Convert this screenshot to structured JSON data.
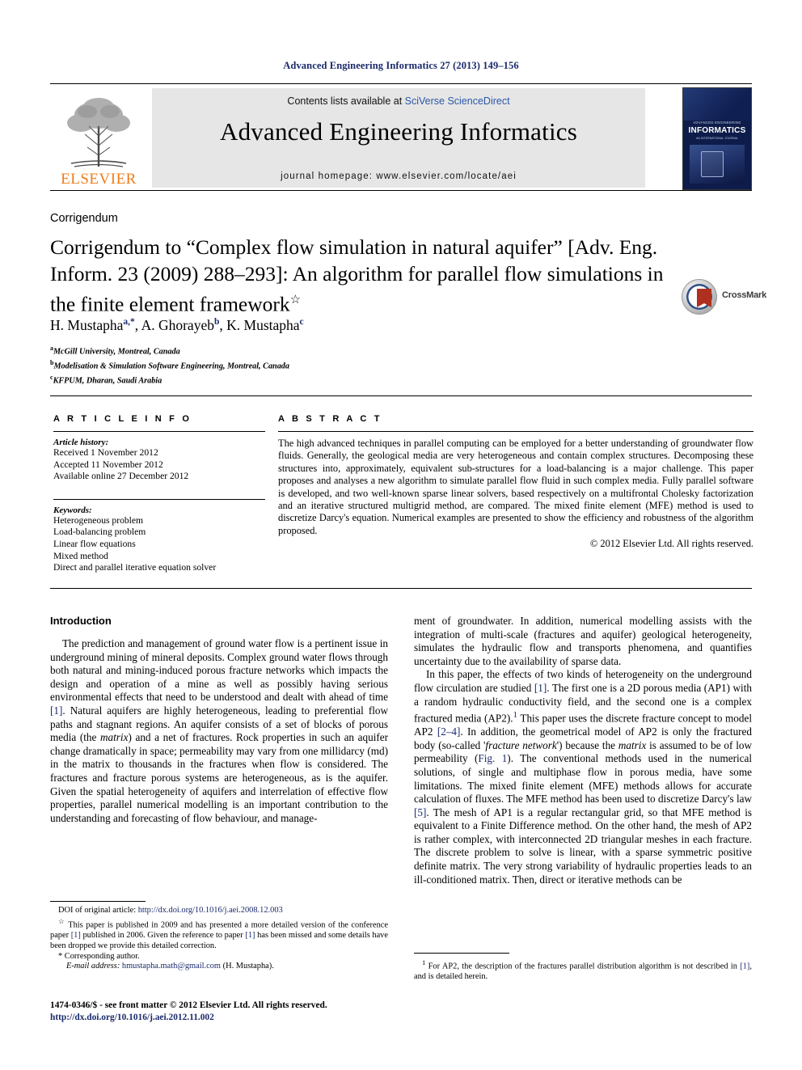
{
  "running_head": "Advanced Engineering Informatics 27 (2013) 149–156",
  "masthead": {
    "contents_prefix": "Contents lists available at ",
    "contents_link": "SciVerse ScienceDirect",
    "journal_title": "Advanced Engineering Informatics",
    "homepage": "journal homepage: www.elsevier.com/locate/aei",
    "publisher_name": "ELSEVIER",
    "cover": {
      "series": "ADVANCED ENGINEERING",
      "name": "INFORMATICS",
      "subtitle": "AN INTERNATIONAL JOURNAL"
    }
  },
  "article_category": "Corrigendum",
  "title": "Corrigendum to “Complex flow simulation in natural aquifer” [Adv. Eng. Inform. 23 (2009) 288–293]: An algorithm for parallel flow simulations in the finite element framework",
  "title_marker": "☆",
  "crossmark_label": "CrossMark",
  "authors": [
    {
      "name": "H. Mustapha",
      "marks": "a,*"
    },
    {
      "name": "A. Ghorayeb",
      "marks": "b"
    },
    {
      "name": "K. Mustapha",
      "marks": "c"
    }
  ],
  "affiliations": [
    {
      "mark": "a",
      "text": "McGill University, Montreal, Canada"
    },
    {
      "mark": "b",
      "text": "Modelisation & Simulation Software Engineering, Montreal, Canada"
    },
    {
      "mark": "c",
      "text": "KFPUM, Dharan, Saudi Arabia"
    }
  ],
  "article_info": {
    "heading": "A R T I C L E   I N F O",
    "history_label": "Article history:",
    "history": [
      "Received 1 November 2012",
      "Accepted 11 November 2012",
      "Available online 27 December 2012"
    ],
    "keywords_label": "Keywords:",
    "keywords": [
      "Heterogeneous problem",
      "Load-balancing problem",
      "Linear flow equations",
      "Mixed method",
      "Direct and parallel iterative equation solver"
    ]
  },
  "abstract": {
    "heading": "A B S T R A C T",
    "text": "The high advanced techniques in parallel computing can be employed for a better understanding of groundwater flow fluids. Generally, the geological media are very heterogeneous and contain complex structures. Decomposing these structures into, approximately, equivalent sub-structures for a load-balancing is a major challenge. This paper proposes and analyses a new algorithm to simulate parallel flow fluid in such complex media. Fully parallel software is developed, and two well-known sparse linear solvers, based respectively on a multifrontal Cholesky factorization and an iterative structured multigrid method, are compared. The mixed finite element (MFE) method is used to discretize Darcy's equation. Numerical examples are presented to show the efficiency and robustness of the algorithm proposed.",
    "copyright": "© 2012 Elsevier Ltd. All rights reserved."
  },
  "body": {
    "intro_heading": "Introduction",
    "left_paragraphs": [
      "The prediction and management of ground water flow is a pertinent issue in underground mining of mineral deposits. Complex ground water flows through both natural and mining-induced porous fracture networks which impacts the design and operation of a mine as well as possibly having serious environmental effects that need to be understood and dealt with ahead of time [1]. Natural aquifers are highly heterogeneous, leading to preferential flow paths and stagnant regions. An aquifer consists of a set of blocks of porous media (the matrix) and a net of fractures. Rock properties in such an aquifer change dramatically in space; permeability may vary from one millidarcy (md) in the matrix to thousands in the fractures when flow is considered. The fractures and fracture porous systems are heterogeneous, as is the aquifer. Given the spatial heterogeneity of aquifers and interrelation of effective flow properties, parallel numerical modelling is an important contribution to the understanding and forecasting of flow behaviour, and manage-"
    ],
    "right_paragraphs": [
      "ment of groundwater. In addition, numerical modelling assists with the integration of multi-scale (fractures and aquifer) geological heterogeneity, simulates the hydraulic flow and transports phenomena, and quantifies uncertainty due to the availability of sparse data.",
      "In this paper, the effects of two kinds of heterogeneity on the underground flow circulation are studied [1]. The first one is a 2D porous media (AP1) with a random hydraulic conductivity field, and the second one is a complex fractured media (AP2).1 This paper uses the discrete fracture concept to model AP2 [2–4]. In addition, the geometrical model of AP2 is only the fractured body (so-called 'fracture network') because the matrix is assumed to be of low permeability (Fig. 1). The conventional methods used in the numerical solutions, of single and multiphase flow in porous media, have some limitations. The mixed finite element (MFE) methods allows for accurate calculation of fluxes. The MFE method has been used to discretize Darcy's law [5]. The mesh of AP1 is a regular rectangular grid, so that MFE method is equivalent to a Finite Difference method. On the other hand, the mesh of AP2 is rather complex, with interconnected 2D triangular meshes in each fracture. The discrete problem to solve is linear, with a sparse symmetric positive definite matrix. The very strong variability of hydraulic properties leads to an ill-conditioned matrix. Then, direct or iterative methods can be"
    ]
  },
  "footnotes": {
    "doi_label": "DOI of original article: ",
    "doi_link": "http://dx.doi.org/10.1016/j.aei.2008.12.003",
    "star_note": "This paper is published in 2009 and has presented a more detailed version of the conference paper [1] published in 2006. Given the reference to paper [1] has been missed and some details have been dropped we provide this detailed correction.",
    "corresponding": "Corresponding author.",
    "email_label": "E-mail address:",
    "email": "hmustapha.math@gmail.com",
    "email_owner": "(H. Mustapha).",
    "right_note_marker": "1",
    "right_note": "For AP2, the description of the fractures parallel distribution algorithm is not described in [1], and is detailed herein."
  },
  "footer": {
    "issn_line": "1474-0346/$ - see front matter © 2012 Elsevier Ltd. All rights reserved.",
    "doi_link": "http://dx.doi.org/10.1016/j.aei.2012.11.002"
  }
}
